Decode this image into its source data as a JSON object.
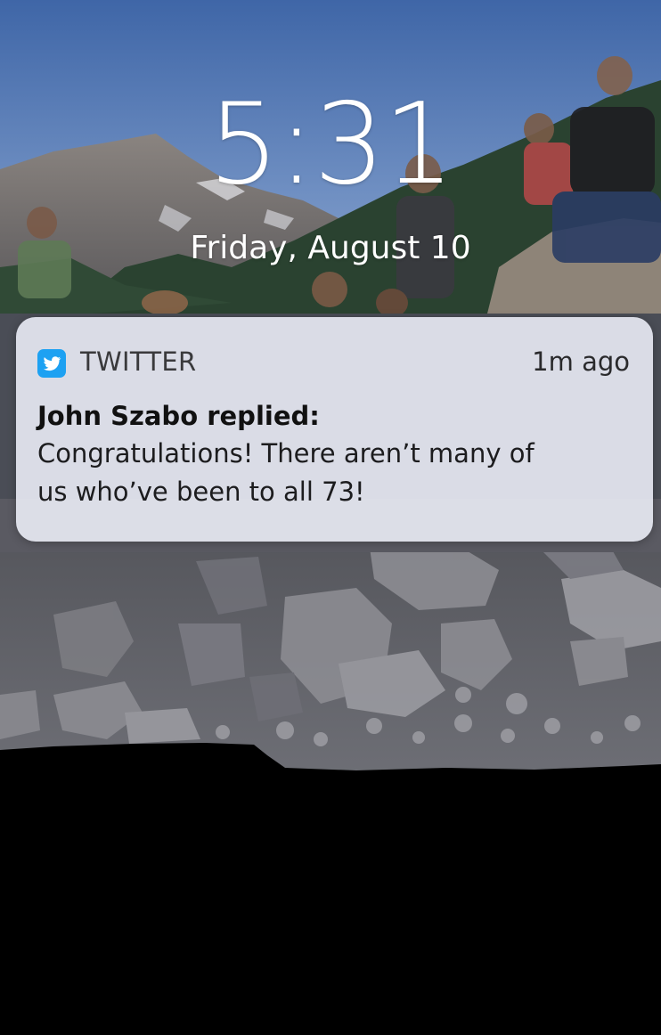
{
  "lock_screen": {
    "time": "5:31",
    "date": "Friday, August 10"
  },
  "notification": {
    "app_icon": "twitter-bird-icon",
    "app_name": "TWITTER",
    "timestamp": "1m ago",
    "title": "John Szabo replied:",
    "body_line1": "Congratulations!  There aren’t many of",
    "body_line2": "us who’ve been to all 73!",
    "accent_color": "#1da1f2"
  },
  "wallpaper": {
    "description_icon": "mountain-photo-wallpaper",
    "sky_color": "#5f7fb6",
    "forest_color": "#27402f",
    "rock_color": "#7a7a80"
  }
}
